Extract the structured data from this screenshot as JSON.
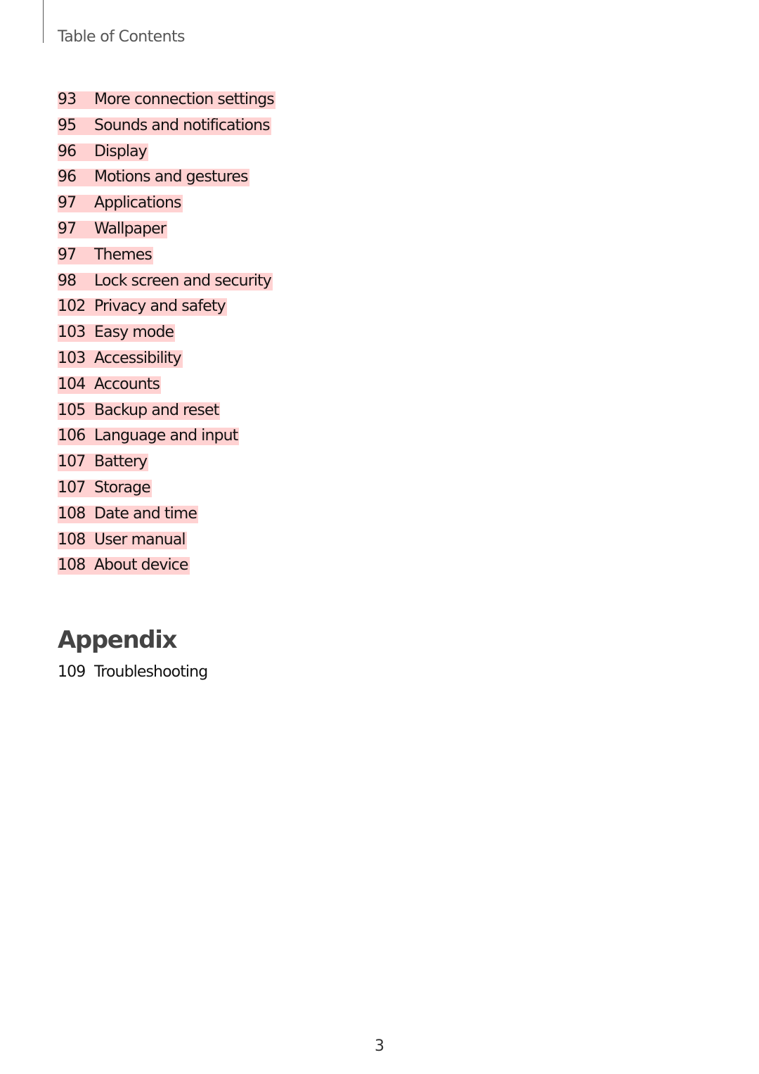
{
  "header": {
    "section_title": "Table of Contents"
  },
  "toc": {
    "highlight_color": "#ffd2d2",
    "items": [
      {
        "page": "93",
        "title": "More connection settings"
      },
      {
        "page": "95",
        "title": "Sounds and notifications"
      },
      {
        "page": "96",
        "title": "Display"
      },
      {
        "page": "96",
        "title": "Motions and gestures"
      },
      {
        "page": "97",
        "title": "Applications"
      },
      {
        "page": "97",
        "title": "Wallpaper"
      },
      {
        "page": "97",
        "title": "Themes"
      },
      {
        "page": "98",
        "title": "Lock screen and security"
      },
      {
        "page": "102",
        "title": "Privacy and safety"
      },
      {
        "page": "103",
        "title": "Easy mode"
      },
      {
        "page": "103",
        "title": "Accessibility"
      },
      {
        "page": "104",
        "title": "Accounts"
      },
      {
        "page": "105",
        "title": "Backup and reset"
      },
      {
        "page": "106",
        "title": "Language and input"
      },
      {
        "page": "107",
        "title": "Battery"
      },
      {
        "page": "107",
        "title": "Storage"
      },
      {
        "page": "108",
        "title": "Date and time"
      },
      {
        "page": "108",
        "title": "User manual"
      },
      {
        "page": "108",
        "title": "About device"
      }
    ]
  },
  "appendix": {
    "title": "Appendix",
    "items": [
      {
        "page": "109",
        "title": "Troubleshooting"
      }
    ]
  },
  "footer": {
    "page_number": "3"
  }
}
